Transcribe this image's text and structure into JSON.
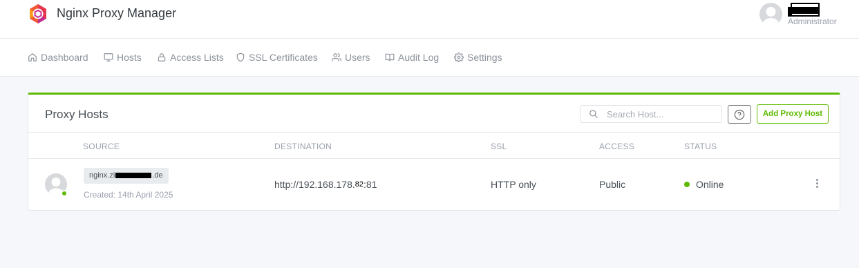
{
  "app": {
    "title": "Nginx Proxy Manager"
  },
  "user": {
    "role": "Administrator"
  },
  "nav": [
    {
      "label": "Dashboard",
      "icon": "home-icon"
    },
    {
      "label": "Hosts",
      "icon": "monitor-icon"
    },
    {
      "label": "Access Lists",
      "icon": "lock-icon"
    },
    {
      "label": "SSL Certificates",
      "icon": "shield-icon"
    },
    {
      "label": "Users",
      "icon": "users-icon"
    },
    {
      "label": "Audit Log",
      "icon": "book-icon"
    },
    {
      "label": "Settings",
      "icon": "gear-icon"
    }
  ],
  "card": {
    "title": "Proxy Hosts",
    "search_placeholder": "Search Host...",
    "add_label": "Add Proxy Host",
    "accent_color": "#5eba00"
  },
  "table": {
    "columns": [
      "SOURCE",
      "DESTINATION",
      "SSL",
      "ACCESS",
      "STATUS"
    ],
    "rows": [
      {
        "domain_start": "nginx.zi",
        "domain_end": ".de",
        "created": "Created: 14th April 2025",
        "destination_prefix": "http://192.168.178.",
        "destination_octet": "82",
        "destination_port": ":81",
        "ssl": "HTTP only",
        "access": "Public",
        "status": "Online"
      }
    ]
  }
}
